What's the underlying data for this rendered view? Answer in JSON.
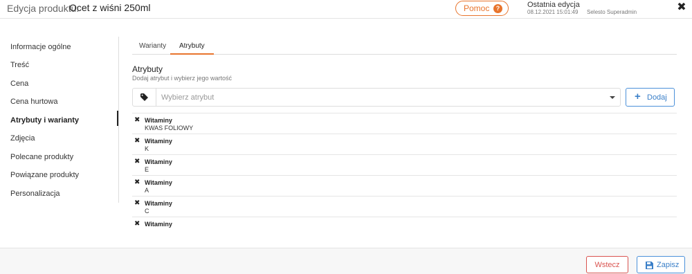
{
  "header": {
    "title_label": "Edycja produktu:",
    "title_value": "Ocet z wiśni 250ml",
    "help_label": "Pomoc",
    "help_icon": "?",
    "last_edit_title": "Ostatnia edycja",
    "last_edit_date": "08.12.2021  15:01:49",
    "last_edit_user": "Selesto Superadmin",
    "close_icon": "✖"
  },
  "sidebar": {
    "items": [
      {
        "label": "Informacje ogólne"
      },
      {
        "label": "Treść"
      },
      {
        "label": "Cena"
      },
      {
        "label": "Cena hurtowa"
      },
      {
        "label": "Atrybuty i warianty"
      },
      {
        "label": "Zdjęcia"
      },
      {
        "label": "Polecane produkty"
      },
      {
        "label": "Powiązane produkty"
      },
      {
        "label": "Personalizacja"
      }
    ],
    "active_index": 4
  },
  "tabs": [
    {
      "label": "Warianty"
    },
    {
      "label": "Atrybuty"
    }
  ],
  "section": {
    "title": "Atrybuty",
    "subtitle": "Dodaj atrybut i wybierz jego wartość"
  },
  "select": {
    "placeholder": "Wybierz atrybut",
    "icon": "tag-icon"
  },
  "add_button": {
    "label": "Dodaj",
    "icon": "+"
  },
  "attributes": [
    {
      "name": "Witaminy",
      "value": "KWAS FOLIOWY"
    },
    {
      "name": "Witaminy",
      "value": "K"
    },
    {
      "name": "Witaminy",
      "value": "E"
    },
    {
      "name": "Witaminy",
      "value": "A"
    },
    {
      "name": "Witaminy",
      "value": "C"
    },
    {
      "name": "Witaminy",
      "value": ""
    }
  ],
  "remove_icon": "✖",
  "footer": {
    "back_label": "Wstecz",
    "save_label": "Zapisz"
  },
  "colors": {
    "accent": "#e8742c",
    "primary": "#3a7fc8",
    "danger": "#d9534f"
  }
}
